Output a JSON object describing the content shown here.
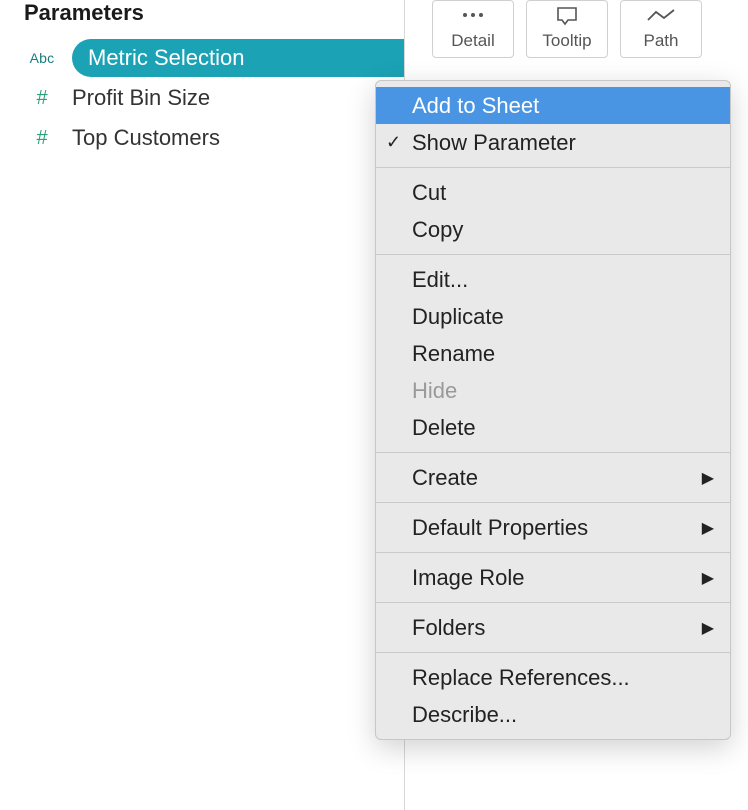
{
  "panel": {
    "title": "Parameters",
    "items": [
      {
        "icon": "Abc",
        "label": "Metric Selection",
        "selected": true
      },
      {
        "icon": "#",
        "label": "Profit Bin Size",
        "selected": false
      },
      {
        "icon": "#",
        "label": "Top Customers",
        "selected": false
      }
    ]
  },
  "marks": {
    "buttons": [
      {
        "name": "detail",
        "label": "Detail"
      },
      {
        "name": "tooltip",
        "label": "Tooltip"
      },
      {
        "name": "path",
        "label": "Path"
      }
    ]
  },
  "context_menu": {
    "groups": [
      [
        {
          "label": "Add to Sheet",
          "highlighted": true
        },
        {
          "label": "Show Parameter",
          "checked": true
        }
      ],
      [
        {
          "label": "Cut"
        },
        {
          "label": "Copy"
        }
      ],
      [
        {
          "label": "Edit..."
        },
        {
          "label": "Duplicate"
        },
        {
          "label": "Rename"
        },
        {
          "label": "Hide",
          "disabled": true
        },
        {
          "label": "Delete"
        }
      ],
      [
        {
          "label": "Create",
          "submenu": true
        }
      ],
      [
        {
          "label": "Default Properties",
          "submenu": true
        }
      ],
      [
        {
          "label": "Image Role",
          "submenu": true
        }
      ],
      [
        {
          "label": "Folders",
          "submenu": true
        }
      ],
      [
        {
          "label": "Replace References..."
        },
        {
          "label": "Describe..."
        }
      ]
    ]
  }
}
